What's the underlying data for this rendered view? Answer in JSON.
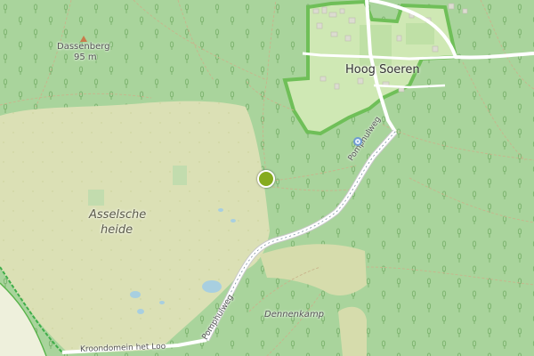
{
  "map": {
    "labels": {
      "dassenberg_name": "Dassenberg",
      "dassenberg_elevation": "95 m",
      "hoog_soeren": "Hoog Soeren",
      "asselsche_heide_line1": "Asselsche",
      "asselsche_heide_line2": "heide",
      "pomphulweg_north": "Pomphulweg",
      "pomphulweg_south": "Pomphulweg",
      "dennenkamp": "Dennenkamp",
      "kroondomein": "Kroondomein het Loo"
    },
    "icons": {
      "location_marker": "location-pin-icon",
      "peak": "peak-triangle-icon",
      "poi": "viewpoint-icon"
    },
    "colors": {
      "forest": "#a9d49c",
      "heath": "#dbe0b5",
      "village_fill": "#cfe8b4",
      "village_border": "#6fbf58",
      "road": "#ffffff",
      "road_outline": "#c8c8c8",
      "marker": "#86ab1e"
    }
  }
}
